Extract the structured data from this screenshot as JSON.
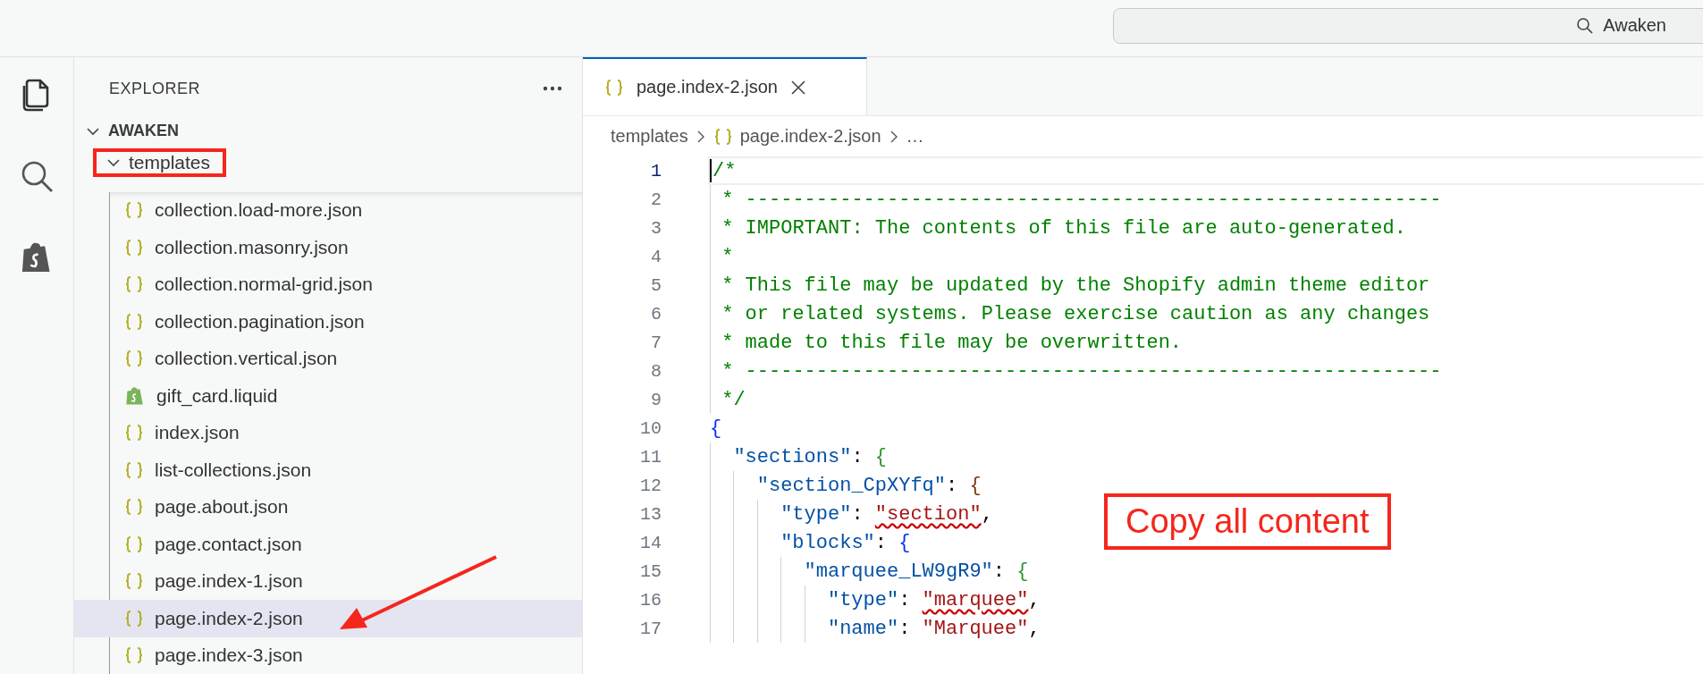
{
  "search": {
    "value": "Awaken"
  },
  "sidebar": {
    "title": "EXPLORER",
    "root": {
      "label": "AWAKEN",
      "expanded": true,
      "children": [
        {
          "label": "templates",
          "expanded": true,
          "marked": true,
          "children": [
            {
              "label": "collection.load-more.json",
              "kind": "json",
              "selected": false
            },
            {
              "label": "collection.masonry.json",
              "kind": "json",
              "selected": false
            },
            {
              "label": "collection.normal-grid.json",
              "kind": "json",
              "selected": false
            },
            {
              "label": "collection.pagination.json",
              "kind": "json",
              "selected": false
            },
            {
              "label": "collection.vertical.json",
              "kind": "json",
              "selected": false
            },
            {
              "label": "gift_card.liquid",
              "kind": "liquid",
              "selected": false
            },
            {
              "label": "index.json",
              "kind": "json",
              "selected": false
            },
            {
              "label": "list-collections.json",
              "kind": "json",
              "selected": false
            },
            {
              "label": "page.about.json",
              "kind": "json",
              "selected": false
            },
            {
              "label": "page.contact.json",
              "kind": "json",
              "selected": false
            },
            {
              "label": "page.index-1.json",
              "kind": "json",
              "selected": false
            },
            {
              "label": "page.index-2.json",
              "kind": "json",
              "selected": true,
              "pointed": true
            },
            {
              "label": "page.index-3.json",
              "kind": "json",
              "selected": false
            }
          ]
        }
      ]
    }
  },
  "tabs": [
    {
      "label": "page.index-2.json",
      "selected": true
    }
  ],
  "breadcrumbs": [
    {
      "label": "templates",
      "kind": "folder"
    },
    {
      "label": "page.index-2.json",
      "kind": "json"
    },
    {
      "label": "…",
      "kind": "more"
    }
  ],
  "editor": {
    "lines": [
      {
        "number": "1",
        "active": true,
        "tokens": [
          {
            "text": "/*",
            "kind": "comment"
          }
        ]
      },
      {
        "number": "2",
        "active": false,
        "tokens": [
          {
            "text": " * -----------------------------------------------------------",
            "kind": "comment"
          }
        ]
      },
      {
        "number": "3",
        "active": false,
        "tokens": [
          {
            "text": " * IMPORTANT: The contents of this file are auto-generated.",
            "kind": "comment"
          }
        ]
      },
      {
        "number": "4",
        "active": false,
        "tokens": [
          {
            "text": " *",
            "kind": "comment"
          }
        ]
      },
      {
        "number": "5",
        "active": false,
        "tokens": [
          {
            "text": " * This file may be updated by the Shopify admin theme editor",
            "kind": "comment"
          }
        ]
      },
      {
        "number": "6",
        "active": false,
        "tokens": [
          {
            "text": " * or related systems. Please exercise caution as any changes",
            "kind": "comment"
          }
        ]
      },
      {
        "number": "7",
        "active": false,
        "tokens": [
          {
            "text": " * made to this file may be overwritten.",
            "kind": "comment"
          }
        ]
      },
      {
        "number": "8",
        "active": false,
        "tokens": [
          {
            "text": " * -----------------------------------------------------------",
            "kind": "comment"
          }
        ]
      },
      {
        "number": "9",
        "active": false,
        "tokens": [
          {
            "text": " */",
            "kind": "comment"
          }
        ]
      },
      {
        "number": "10",
        "active": false,
        "tokens": [
          {
            "text": "{",
            "kind": "bracket",
            "color": "#0431fa"
          }
        ]
      },
      {
        "number": "11",
        "active": false,
        "tokens": [
          {
            "text": "  \"sections\"",
            "kind": "key"
          },
          {
            "text": ": ",
            "kind": "punct"
          },
          {
            "text": "{",
            "kind": "bracket",
            "color": "#319331"
          }
        ]
      },
      {
        "number": "12",
        "active": false,
        "tokens": [
          {
            "text": "    \"section_CpXYfq\"",
            "kind": "key"
          },
          {
            "text": ": ",
            "kind": "punct"
          },
          {
            "text": "{",
            "kind": "bracket",
            "color": "#7b3814"
          }
        ]
      },
      {
        "number": "13",
        "active": false,
        "tokens": [
          {
            "text": "      \"type\"",
            "kind": "key"
          },
          {
            "text": ": ",
            "kind": "punct"
          },
          {
            "text": "\"section\"",
            "kind": "flagged"
          },
          {
            "text": ",",
            "kind": "punct"
          }
        ]
      },
      {
        "number": "14",
        "active": false,
        "tokens": [
          {
            "text": "      \"blocks\"",
            "kind": "key"
          },
          {
            "text": ": ",
            "kind": "punct"
          },
          {
            "text": "{",
            "kind": "bracket",
            "color": "#0431fa"
          }
        ]
      },
      {
        "number": "15",
        "active": false,
        "tokens": [
          {
            "text": "        \"marquee_LW9gR9\"",
            "kind": "key"
          },
          {
            "text": ": ",
            "kind": "punct"
          },
          {
            "text": "{",
            "kind": "bracket",
            "color": "#319331"
          }
        ]
      },
      {
        "number": "16",
        "active": false,
        "tokens": [
          {
            "text": "          \"type\"",
            "kind": "key"
          },
          {
            "text": ": ",
            "kind": "punct"
          },
          {
            "text": "\"marquee\"",
            "kind": "flagged"
          },
          {
            "text": ",",
            "kind": "punct"
          }
        ]
      },
      {
        "number": "17",
        "active": false,
        "tokens": [
          {
            "text": "          \"name\"",
            "kind": "key"
          },
          {
            "text": ": ",
            "kind": "punct"
          },
          {
            "text": "\"Marquee\"",
            "kind": "string"
          },
          {
            "text": ",",
            "kind": "punct"
          }
        ]
      }
    ]
  },
  "annotation": {
    "callout": "Copy all content"
  }
}
